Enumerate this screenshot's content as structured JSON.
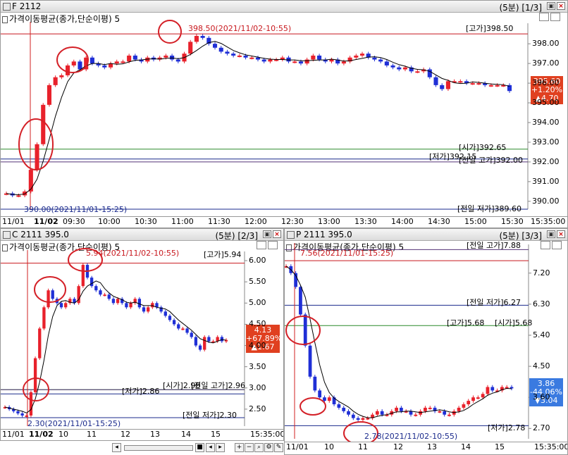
{
  "panels": {
    "f": {
      "title": "F 2112",
      "page": "(5분) [1/3]",
      "indicator": "가격이동평균(종가,단순이평) 5",
      "high_label": "398.50(2021/11/02-10:55)",
      "low_label": "390.00(2021/11/01-15:25)",
      "lines": [
        "[고가]398.50",
        "[시가]392.65",
        "[저가]392.15",
        "[전일 고가]392.00",
        "[전일 저가]389.60"
      ],
      "y_ticks": [
        "398.00",
        "397.00",
        "396.00",
        "395.00",
        "394.00",
        "393.00",
        "392.00",
        "391.00",
        "390.00"
      ],
      "x_ticks": [
        "11/01",
        "11/02",
        "09:30",
        "10:00",
        "10:30",
        "11:00",
        "11:30",
        "12:00",
        "12:30",
        "13:00",
        "13:30",
        "14:00",
        "14:30",
        "15:00",
        "15:30",
        "15:35:00"
      ],
      "badge": [
        "395.60",
        "+1.20%",
        "▲4.70"
      ]
    },
    "c": {
      "title": "C 2111 395.0",
      "page": "(5분) [2/3]",
      "indicator": "가격이동평균(종가,단순이평) 5",
      "high_label": "5.94(2021/11/02-10:55)",
      "low_label": "2.30(2021/11/01-15:25)",
      "lines": [
        "[고가]5.94",
        "[저가]2.86",
        "[시가]2.96",
        "[전일 고가]2.96",
        "[전일 저가]2.30"
      ],
      "y_ticks": [
        "6.00",
        "5.50",
        "5.00",
        "4.50",
        "4.00",
        "3.50",
        "3.00",
        "2.50"
      ],
      "x_ticks": [
        "11/01",
        "11/02",
        "10",
        "11",
        "12",
        "13",
        "14",
        "15",
        "15:35:00"
      ],
      "badge": [
        "4.13",
        "+67.89%",
        "▲1.67"
      ]
    },
    "p": {
      "title": "P 2111 395.0",
      "page": "(5분) [3/3]",
      "indicator": "가격이동평균(종가,단순이평) 5",
      "high_label": "7.56(2021/11/01-15:25)",
      "low_label": "2.78(2021/11/02-10:55)",
      "lines": [
        "[전일 고가]7.88",
        "[전일 저가]6.27",
        "[고가]5.68",
        "[시가]5.68",
        "[저가]2.78"
      ],
      "y_ticks": [
        "7.20",
        "6.30",
        "5.40",
        "4.50",
        "3.60",
        "2.70"
      ],
      "x_ticks": [
        "11/01",
        "10",
        "11",
        "12",
        "13",
        "14",
        "15",
        "15:35:00"
      ],
      "badge": [
        "3.86",
        "-44.06%",
        "▼3.04"
      ]
    }
  },
  "colors": {
    "up": "#e8212b",
    "down": "#1f2fd6",
    "ma": "#000000",
    "high_line": "#c8181e",
    "low_line": "#1a2a8c",
    "open_line": "#2a8a2a",
    "circle": "#d42027"
  },
  "chart_data": [
    {
      "type": "candlestick",
      "title": "F 2112",
      "ylim": [
        389.6,
        398.9
      ],
      "y_ticks": [
        398,
        397,
        396,
        395,
        394,
        393,
        392,
        391,
        390
      ],
      "x_labels": [
        "11/01",
        "11/02",
        "09:30",
        "10:00",
        "10:30",
        "11:00",
        "11:30",
        "12:00",
        "12:30",
        "13:00",
        "13:30",
        "14:00",
        "14:30",
        "15:00",
        "15:30"
      ],
      "close_path": [
        390.4,
        390.3,
        390.3,
        390.5,
        391.6,
        392.9,
        394.9,
        395.9,
        396.3,
        396.4,
        396.9,
        397.1,
        396.7,
        397.3,
        397.0,
        396.9,
        396.8,
        397.0,
        397.1,
        397.1,
        397.4,
        397.2,
        397.1,
        397.3,
        397.2,
        397.3,
        397.4,
        397.2,
        397.1,
        397.5,
        398.1,
        398.4,
        398.3,
        398.0,
        397.8,
        397.6,
        397.5,
        397.4,
        397.4,
        397.3,
        397.3,
        397.2,
        397.1,
        397.2,
        397.2,
        397.3,
        397.1,
        397.1,
        397.0,
        397.2,
        397.4,
        397.2,
        397.1,
        397.2,
        397.0,
        397.1,
        397.3,
        397.4,
        397.5,
        397.3,
        397.2,
        397.1,
        396.9,
        396.8,
        396.7,
        396.8,
        396.6,
        396.6,
        396.7,
        396.3,
        395.9,
        395.7,
        396.1,
        396.1,
        396.1,
        396.0,
        396.0,
        396.0,
        395.9,
        395.9,
        395.9,
        395.9,
        395.6
      ],
      "high": 398.5,
      "low": 390.0,
      "open": 392.65,
      "day_low": 392.15,
      "prev_high": 392.0,
      "prev_low": 389.6,
      "last": 395.6
    },
    {
      "type": "candlestick",
      "title": "C 2111 395.0",
      "ylim": [
        2.1,
        6.15
      ],
      "y_ticks": [
        6.0,
        5.5,
        5.0,
        4.5,
        4.0,
        3.5,
        3.0,
        2.5
      ],
      "x_labels": [
        "11/01",
        "11/02",
        "10",
        "11",
        "12",
        "13",
        "14",
        "15"
      ],
      "close_path": [
        2.55,
        2.5,
        2.45,
        2.4,
        2.35,
        2.35,
        2.9,
        3.7,
        4.4,
        4.9,
        5.3,
        5.1,
        5.0,
        4.9,
        5.0,
        5.1,
        5.0,
        5.4,
        5.9,
        5.6,
        5.4,
        5.3,
        5.2,
        5.2,
        5.1,
        5.0,
        5.1,
        5.0,
        4.9,
        5.0,
        5.1,
        4.9,
        4.8,
        4.9,
        5.0,
        4.9,
        4.8,
        4.7,
        4.6,
        4.5,
        4.4,
        4.4,
        4.3,
        4.2,
        4.0,
        3.9,
        4.2,
        4.1,
        4.1,
        4.2,
        4.1,
        4.13
      ],
      "high": 5.94,
      "low": 2.3,
      "open": 2.96,
      "day_low": 2.86,
      "prev_high": 2.96,
      "prev_low": 2.3,
      "last": 4.13
    },
    {
      "type": "candlestick",
      "title": "P 2111 395.0",
      "ylim": [
        2.4,
        7.95
      ],
      "y_ticks": [
        7.2,
        6.3,
        5.4,
        4.5,
        3.6,
        2.7
      ],
      "x_labels": [
        "11/01",
        "10",
        "11",
        "12",
        "13",
        "14",
        "15"
      ],
      "close_path": [
        7.4,
        7.2,
        6.8,
        6.0,
        5.1,
        4.2,
        3.8,
        3.6,
        3.5,
        3.6,
        3.4,
        3.3,
        3.2,
        3.1,
        3.0,
        2.95,
        3.0,
        3.0,
        3.1,
        3.2,
        3.1,
        3.1,
        3.2,
        3.3,
        3.2,
        3.2,
        3.1,
        3.1,
        3.2,
        3.3,
        3.3,
        3.2,
        3.2,
        3.1,
        3.1,
        3.2,
        3.3,
        3.4,
        3.5,
        3.6,
        3.6,
        3.7,
        3.9,
        3.8,
        3.8,
        3.9,
        3.9,
        3.86
      ],
      "high": 7.56,
      "low": 2.78,
      "open": 5.68,
      "day_low": 2.78,
      "prev_high": 7.88,
      "prev_low": 6.27,
      "last": 3.86
    }
  ]
}
